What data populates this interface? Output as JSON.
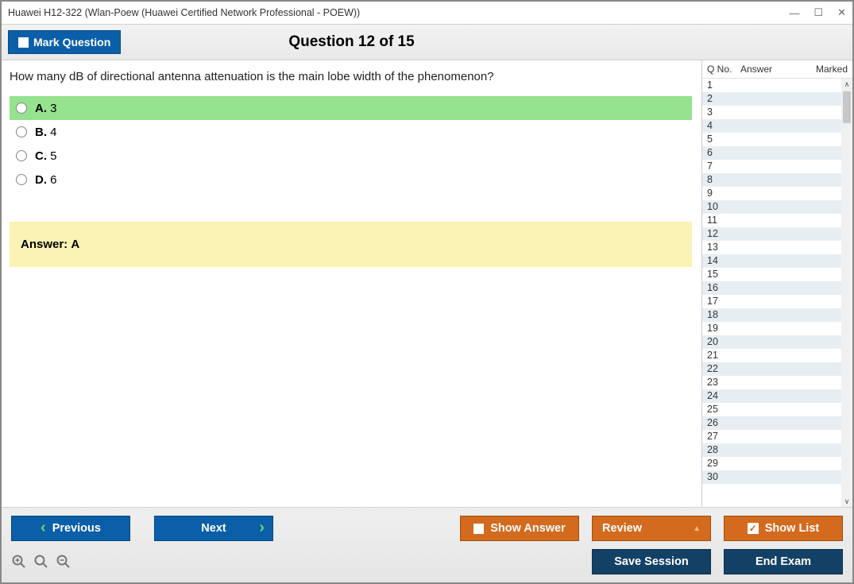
{
  "window_title": "Huawei H12-322 (Wlan-Poew (Huawei Certified Network Professional - POEW))",
  "header": {
    "mark_label": "Mark Question",
    "counter": "Question 12 of 15"
  },
  "question": {
    "text": "How many dB of directional antenna attenuation is the main lobe width of the phenomenon?",
    "options": [
      {
        "letter": "A.",
        "text": "3",
        "selected": true
      },
      {
        "letter": "B.",
        "text": "4",
        "selected": false
      },
      {
        "letter": "C.",
        "text": "5",
        "selected": false
      },
      {
        "letter": "D.",
        "text": "6",
        "selected": false
      }
    ],
    "answer_label": "Answer:",
    "answer_value": "A"
  },
  "sidebar": {
    "col_qno": "Q No.",
    "col_answer": "Answer",
    "col_marked": "Marked",
    "rows": [
      1,
      2,
      3,
      4,
      5,
      6,
      7,
      8,
      9,
      10,
      11,
      12,
      13,
      14,
      15,
      16,
      17,
      18,
      19,
      20,
      21,
      22,
      23,
      24,
      25,
      26,
      27,
      28,
      29,
      30
    ]
  },
  "footer": {
    "previous": "Previous",
    "next": "Next",
    "show_answer": "Show Answer",
    "review": "Review",
    "show_list": "Show List",
    "save_session": "Save Session",
    "end_exam": "End Exam"
  }
}
